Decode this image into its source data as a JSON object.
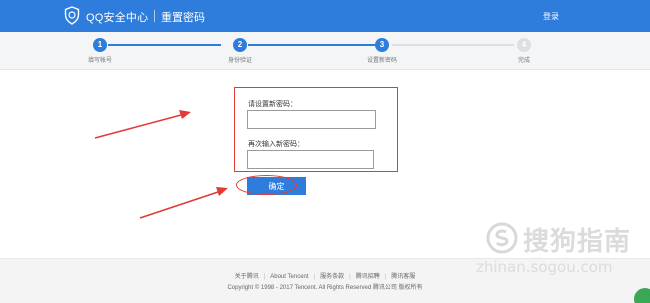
{
  "header": {
    "brand": "QQ安全中心",
    "page_name": "重置密码",
    "login": "登录",
    "logo_icon": "shield-icon",
    "background": "#2e7cdc"
  },
  "steps": [
    {
      "number": "1",
      "label": "填写帐号",
      "state": "done"
    },
    {
      "number": "2",
      "label": "身份验证",
      "state": "done"
    },
    {
      "number": "3",
      "label": "设置新密码",
      "state": "current"
    },
    {
      "number": "4",
      "label": "完成",
      "state": "pending"
    }
  ],
  "form": {
    "new_password_label": "请设置新密码：",
    "new_password_value": "",
    "confirm_password_label": "再次输入新密码：",
    "confirm_password_value": "",
    "confirm_button": "确定"
  },
  "footer": {
    "links": [
      "关于腾讯",
      "About Tencent",
      "服务条款",
      "腾讯招聘",
      "腾讯客服"
    ],
    "copyright": "Copyright © 1998 - 2017 Tencent. All Rights Reserved 腾讯公司 版权所有"
  },
  "watermark": {
    "text": "搜狗指南",
    "url": "zhinan.sogou.com"
  },
  "colors": {
    "accent": "#2e7cdc",
    "annotation": "#e53935",
    "step_inactive": "#dcdfe4"
  }
}
